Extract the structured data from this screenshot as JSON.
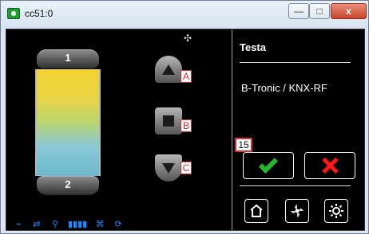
{
  "window": {
    "title": "cc51:0",
    "minimize_glyph": "—",
    "maximize_glyph": "□",
    "close_glyph": "x"
  },
  "blind": {
    "top_label": "1",
    "bottom_label": "2"
  },
  "controls": {
    "up_badge": "A",
    "stop_badge": "B",
    "down_badge": "C"
  },
  "panel": {
    "title": "Testa",
    "device": "B-Tronic / KNX-RF",
    "ok_badge": "15"
  },
  "status_bar": {
    "items": [
      "⌁",
      "⇄",
      "⚲",
      "▮▮▮▮",
      "⌘",
      "⟳"
    ]
  },
  "icons": {
    "app": "app-icon",
    "close_dot": "move-icon",
    "home": "home-icon",
    "fan": "fan-icon",
    "settings": "gear-icon"
  },
  "colors": {
    "ok": "#22b92f",
    "cancel": "#ff1717",
    "status": "#1687ff",
    "badge": "#e12a2a"
  }
}
